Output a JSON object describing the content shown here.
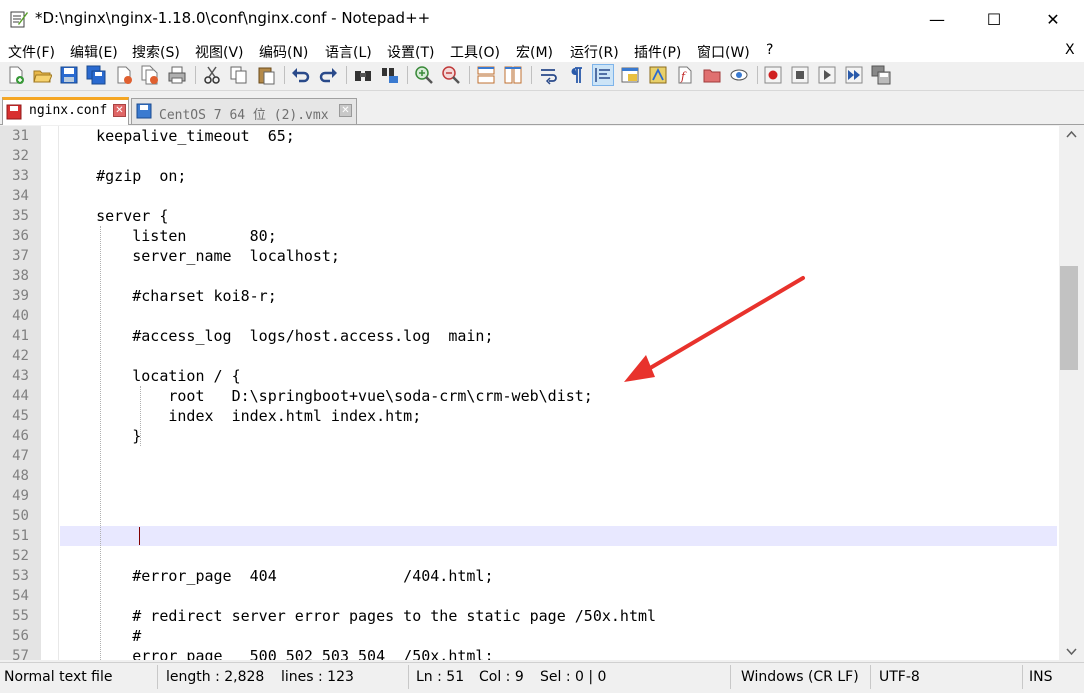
{
  "window": {
    "title": "*D:\\nginx\\nginx-1.18.0\\conf\\nginx.conf - Notepad++",
    "minimize": "—",
    "maximize": "☐",
    "close": "✕"
  },
  "menu": {
    "items": [
      "文件(F)",
      "编辑(E)",
      "搜索(S)",
      "视图(V)",
      "编码(N)",
      "语言(L)",
      "设置(T)",
      "工具(O)",
      "宏(M)",
      "运行(R)",
      "插件(P)",
      "窗口(W)",
      "?"
    ],
    "close": "X"
  },
  "toolbar": {
    "icons": [
      "new-file-icon",
      "open-file-icon",
      "save-icon",
      "save-all-icon",
      "close-file-icon",
      "close-all-icon",
      "print-icon",
      "cut-icon",
      "copy-icon",
      "paste-icon",
      "undo-icon",
      "redo-icon",
      "find-icon",
      "replace-icon",
      "zoom-in-icon",
      "zoom-out-icon",
      "sync-vertical-icon",
      "sync-horizontal-icon",
      "word-wrap-icon",
      "show-all-chars-icon",
      "indent-guide-icon",
      "user-language-icon",
      "doc-map-icon",
      "function-list-icon",
      "folder-workspace-icon",
      "monitor-icon",
      "record-macro-icon",
      "stop-record-icon",
      "play-macro-icon",
      "run-macro-multiple-icon",
      "save-macro-icon"
    ]
  },
  "tabs": [
    {
      "label": "nginx.conf",
      "active": true
    },
    {
      "label": "CentOS 7 64 位 (2).vmx",
      "active": false
    }
  ],
  "editor": {
    "lines": [
      {
        "num": "31",
        "text": "    keepalive_timeout  65;"
      },
      {
        "num": "32",
        "text": ""
      },
      {
        "num": "33",
        "text": "    #gzip  on;"
      },
      {
        "num": "34",
        "text": ""
      },
      {
        "num": "35",
        "text": "    server {"
      },
      {
        "num": "36",
        "text": "        listen       80;"
      },
      {
        "num": "37",
        "text": "        server_name  localhost;"
      },
      {
        "num": "38",
        "text": ""
      },
      {
        "num": "39",
        "text": "        #charset koi8-r;"
      },
      {
        "num": "40",
        "text": ""
      },
      {
        "num": "41",
        "text": "        #access_log  logs/host.access.log  main;"
      },
      {
        "num": "42",
        "text": ""
      },
      {
        "num": "43",
        "text": "        location / {"
      },
      {
        "num": "44",
        "text": "            root   D:\\springboot+vue\\soda-crm\\crm-web\\dist;"
      },
      {
        "num": "45",
        "text": "            index  index.html index.htm;"
      },
      {
        "num": "46",
        "text": "        }"
      },
      {
        "num": "47",
        "text": ""
      },
      {
        "num": "48",
        "text": ""
      },
      {
        "num": "49",
        "text": ""
      },
      {
        "num": "50",
        "text": ""
      },
      {
        "num": "51",
        "text": ""
      },
      {
        "num": "52",
        "text": ""
      },
      {
        "num": "53",
        "text": "        #error_page  404              /404.html;"
      },
      {
        "num": "54",
        "text": ""
      },
      {
        "num": "55",
        "text": "        # redirect server error pages to the static page /50x.html"
      },
      {
        "num": "56",
        "text": "        #"
      },
      {
        "num": "57",
        "text": "        error_page   500 502 503 504  /50x.html;"
      }
    ]
  },
  "annotation": {
    "color": "#e8322c"
  },
  "status": {
    "file_type": "Normal text file",
    "length": "length : 2,828",
    "lines": "lines : 123",
    "ln": "Ln : 51",
    "col": "Col : 9",
    "sel": "Sel : 0 | 0",
    "eol": "Windows (CR LF)",
    "encoding": "UTF-8",
    "mode": "INS"
  }
}
